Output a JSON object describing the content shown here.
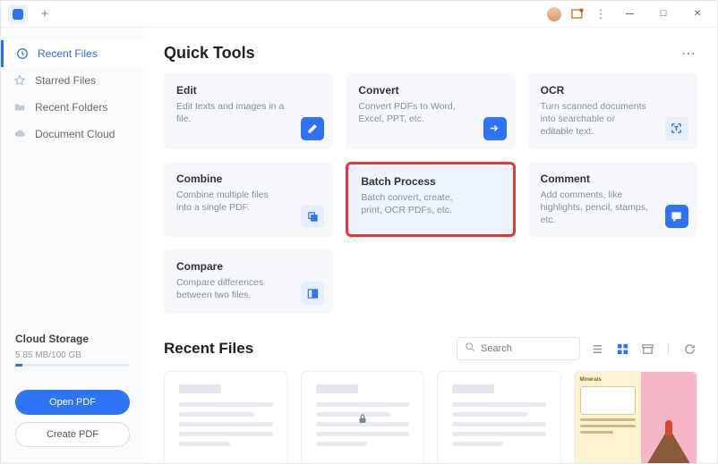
{
  "titlebar": {
    "new_tab_glyph": "+",
    "more_glyph": "⋮"
  },
  "sidebar": {
    "items": [
      {
        "id": "recent-files",
        "label": "Recent Files"
      },
      {
        "id": "starred-files",
        "label": "Starred Files"
      },
      {
        "id": "recent-folders",
        "label": "Recent Folders"
      },
      {
        "id": "document-cloud",
        "label": "Document Cloud"
      }
    ],
    "cloud": {
      "title": "Cloud Storage",
      "usage": "5.85 MB/100 GB"
    },
    "buttons": {
      "open": "Open PDF",
      "create": "Create PDF"
    }
  },
  "quick_tools": {
    "title": "Quick Tools",
    "more_glyph": "⋯",
    "cards": [
      {
        "id": "edit",
        "title": "Edit",
        "desc": "Edit texts and images in a file."
      },
      {
        "id": "convert",
        "title": "Convert",
        "desc": "Convert PDFs to Word, Excel, PPT, etc."
      },
      {
        "id": "ocr",
        "title": "OCR",
        "desc": "Turn scanned documents into searchable or editable text."
      },
      {
        "id": "combine",
        "title": "Combine",
        "desc": "Combine multiple files into a single PDF."
      },
      {
        "id": "batch",
        "title": "Batch Process",
        "desc": "Batch convert, create, print, OCR PDFs, etc.",
        "highlight": true
      },
      {
        "id": "comment",
        "title": "Comment",
        "desc": "Add comments, like highlights, pencil, stamps, etc."
      },
      {
        "id": "compare",
        "title": "Compare",
        "desc": "Compare differences between two files."
      }
    ]
  },
  "recent_files": {
    "title": "Recent Files",
    "search_placeholder": "Search",
    "items": [
      {
        "type": "placeholder"
      },
      {
        "type": "placeholder",
        "locked": true
      },
      {
        "type": "placeholder"
      },
      {
        "type": "thumb",
        "left_title": "Minerals"
      }
    ]
  }
}
